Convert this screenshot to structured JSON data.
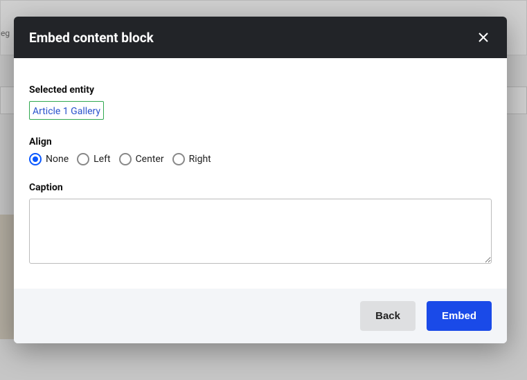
{
  "background": {
    "fragment_text": "eg"
  },
  "modal": {
    "title": "Embed content block",
    "selected_entity": {
      "label": "Selected entity",
      "value": "Article 1 Gallery"
    },
    "align": {
      "label": "Align",
      "selected": "none",
      "options": [
        {
          "key": "none",
          "label": "None"
        },
        {
          "key": "left",
          "label": "Left"
        },
        {
          "key": "center",
          "label": "Center"
        },
        {
          "key": "right",
          "label": "Right"
        }
      ]
    },
    "caption": {
      "label": "Caption",
      "value": ""
    },
    "buttons": {
      "back": "Back",
      "embed": "Embed"
    }
  }
}
